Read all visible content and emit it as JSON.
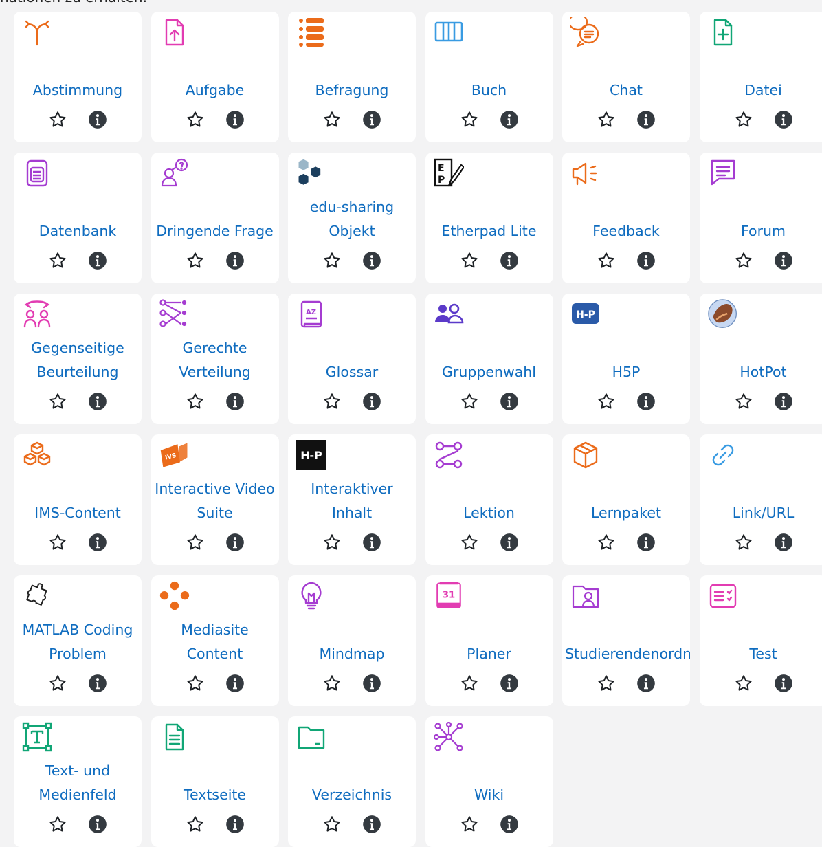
{
  "header": {
    "partial_text": "nationen zu erhalten."
  },
  "colors": {
    "link": "#0f6cbf",
    "admin": "#eb6b1a",
    "content": "#399be2",
    "collab": "#5b3ac9",
    "communication": "#11a676",
    "assessment": "#e23cb2",
    "interactive": "#a53cd1"
  },
  "activities": [
    {
      "label": "Abstimmung",
      "icon": "choice-icon"
    },
    {
      "label": "Aufgabe",
      "icon": "assignment-icon"
    },
    {
      "label": "Befragung",
      "icon": "questionnaire-icon"
    },
    {
      "label": "Buch",
      "icon": "book-icon"
    },
    {
      "label": "Chat",
      "icon": "chat-icon"
    },
    {
      "label": "Datei",
      "icon": "file-icon"
    },
    {
      "label": "Datenbank",
      "icon": "database-icon"
    },
    {
      "label": "Dringende Frage",
      "icon": "urgent-question-icon"
    },
    {
      "label": "edu-sharing Objekt",
      "icon": "edu-sharing-icon"
    },
    {
      "label": "Etherpad Lite",
      "icon": "etherpad-icon"
    },
    {
      "label": "Feedback",
      "icon": "feedback-icon"
    },
    {
      "label": "Forum",
      "icon": "forum-icon"
    },
    {
      "label": "Gegenseitige Beurteilung",
      "icon": "workshop-icon"
    },
    {
      "label": "Gerechte Verteilung",
      "icon": "ratingallocate-icon"
    },
    {
      "label": "Glossar",
      "icon": "glossary-icon"
    },
    {
      "label": "Gruppenwahl",
      "icon": "group-choice-icon"
    },
    {
      "label": "H5P",
      "icon": "h5p-icon"
    },
    {
      "label": "HotPot",
      "icon": "hotpot-icon"
    },
    {
      "label": "IMS-Content",
      "icon": "ims-content-icon"
    },
    {
      "label": "Interactive Video Suite",
      "icon": "video-suite-icon"
    },
    {
      "label": "Interaktiver Inhalt",
      "icon": "h5p-black-icon"
    },
    {
      "label": "Lektion",
      "icon": "lesson-icon"
    },
    {
      "label": "Lernpaket",
      "icon": "package-icon"
    },
    {
      "label": "Link/URL",
      "icon": "link-icon"
    },
    {
      "label": "MATLAB Coding Problem",
      "icon": "puzzle-icon"
    },
    {
      "label": "Mediasite Content",
      "icon": "mediasite-icon"
    },
    {
      "label": "Mindmap",
      "icon": "lightbulb-icon"
    },
    {
      "label": "Planer",
      "icon": "calendar-icon"
    },
    {
      "label": "Studierendenordner",
      "icon": "student-folder-icon"
    },
    {
      "label": "Test",
      "icon": "quiz-icon"
    },
    {
      "label": "Text- und Medienfeld",
      "icon": "text-media-icon"
    },
    {
      "label": "Textseite",
      "icon": "page-icon"
    },
    {
      "label": "Verzeichnis",
      "icon": "folder-icon"
    },
    {
      "label": "Wiki",
      "icon": "wiki-icon"
    }
  ]
}
